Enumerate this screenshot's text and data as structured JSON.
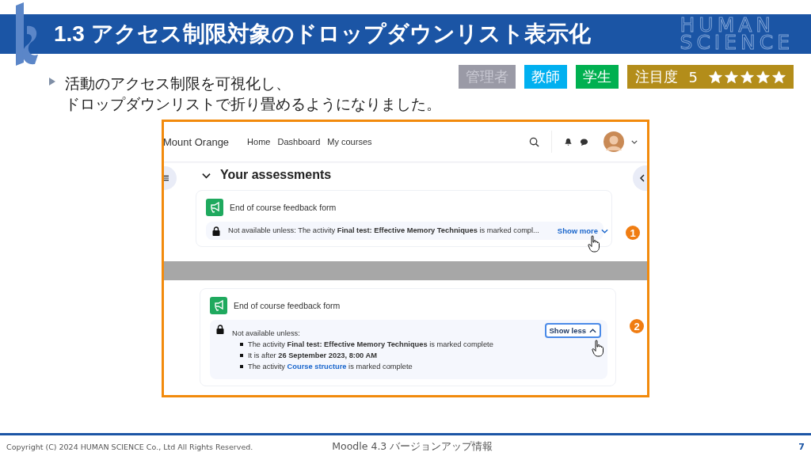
{
  "slide": {
    "title": "1.3 アクセス制限対象のドロップダウンリスト表示化",
    "brand": [
      "HUMAN",
      "SCIENCE"
    ]
  },
  "tags": [
    {
      "label": "管理者",
      "on": false
    },
    {
      "label": "教師",
      "on": true,
      "color": "#00b0f0"
    },
    {
      "label": "学生",
      "on": true,
      "color": "#00b050"
    }
  ],
  "attention": {
    "label": "注目度",
    "score": "5",
    "stars": 5
  },
  "bullet": [
    "活動のアクセス制限を可視化し、",
    "ドロップダウンリストで折り畳めるようになりました。"
  ],
  "screenshot": {
    "site_name": "Mount Orange",
    "nav": [
      "Home",
      "Dashboard",
      "My courses"
    ],
    "section": {
      "title": "Your assessments",
      "expanded": true
    },
    "cards": [
      {
        "title": "End of course feedback form",
        "expanded": false,
        "summary": "Not available unless: The activity **Final test: Effective Memory Techniques** is marked compl...",
        "toggle": "Show more",
        "callout": "1"
      },
      {
        "title": "End of course feedback form",
        "expanded": true,
        "intro": "Not available unless:",
        "conditions": [
          {
            "kind": "text",
            "text": "The activity **Final test: Effective Memory Techniques** is marked complete"
          },
          {
            "kind": "text",
            "text": "It is after **26 September 2023, 8:00 AM**"
          },
          {
            "kind": "link",
            "before": "The activity",
            "link": "Course structure",
            "after": "is marked complete"
          }
        ],
        "toggle": "Show less",
        "callout": "2"
      }
    ]
  },
  "footer": {
    "copyright": "Copyright (C) 2024 HUMAN SCIENCE Co., Ltd All Rights Reserved.",
    "center": "Moodle 4.3 バージョンアップ情報",
    "page": "7"
  }
}
